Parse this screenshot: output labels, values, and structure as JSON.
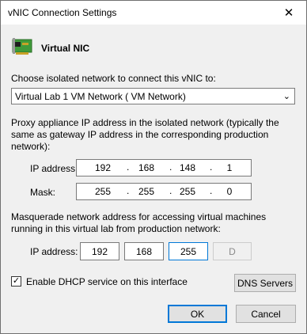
{
  "window": {
    "title": "vNIC Connection Settings",
    "close_glyph": "✕"
  },
  "header": {
    "title": "Virtual NIC",
    "icon": "network-card-icon"
  },
  "network": {
    "label": "Choose isolated network to connect this vNIC to:",
    "selected": "Virtual Lab 1 VM Network ( VM Network)",
    "arrow": "⌄"
  },
  "proxy": {
    "label_line1": "Proxy appliance IP address in the isolated network (typically the",
    "label_line2": "same as gateway IP address in the corresponding production",
    "label_line3": "network):",
    "ip_label": "IP address:",
    "ip": [
      "192",
      "168",
      "148",
      "1"
    ],
    "mask_label": "Mask:",
    "mask": [
      "255",
      "255",
      "255",
      "0"
    ]
  },
  "masquerade": {
    "label_line1": "Masquerade network address for accessing virtual machines",
    "label_line2": "running in this virtual lab from production network:",
    "ip_label": "IP address:",
    "octets": [
      "192",
      "168",
      "255",
      "D"
    ]
  },
  "dhcp": {
    "checked_glyph": "✓",
    "label": "Enable DHCP service on this interface"
  },
  "buttons": {
    "dns": "DNS Servers",
    "ok": "OK",
    "cancel": "Cancel"
  },
  "dot": "."
}
